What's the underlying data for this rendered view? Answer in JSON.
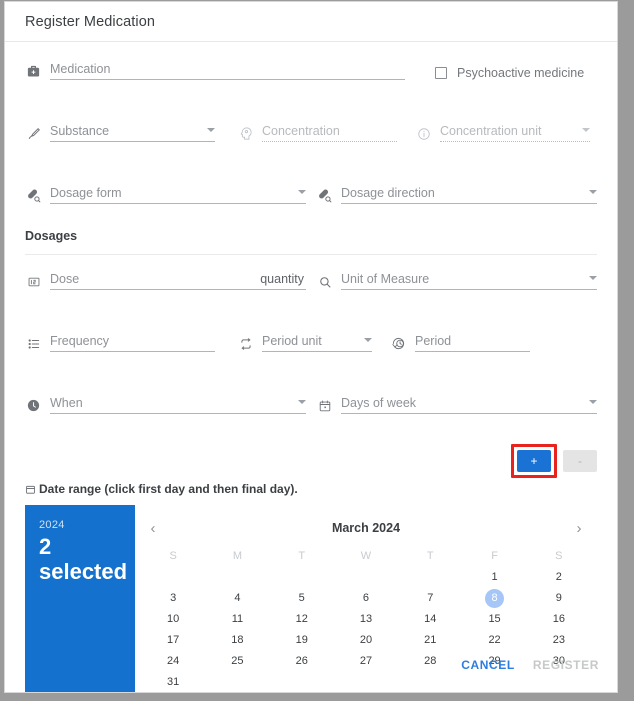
{
  "dialog": {
    "title": "Register Medication"
  },
  "fields": {
    "medication": {
      "placeholder": "Medication",
      "icon": "medical-kit-icon"
    },
    "psychoactive": {
      "label": "Psychoactive medicine",
      "checked": false
    },
    "substance": {
      "placeholder": "Substance",
      "icon": "syringe-icon"
    },
    "concentration": {
      "placeholder": "Concentration",
      "icon": "head-concentration-icon",
      "disabled": true
    },
    "concentration_unit": {
      "placeholder": "Concentration unit",
      "icon": "info-circle-icon",
      "disabled": true
    },
    "dosage_form": {
      "placeholder": "Dosage form",
      "icon": "pill-search-icon"
    },
    "dosage_direction": {
      "placeholder": "Dosage direction",
      "icon": "pill-search-icon"
    },
    "dose": {
      "placeholder": "Dose",
      "suffix": "quantity",
      "icon": "number-box-icon"
    },
    "unit_of_measure": {
      "placeholder": "Unit of Measure",
      "icon": "magnifier-icon"
    },
    "frequency": {
      "placeholder": "Frequency",
      "icon": "list-icon"
    },
    "period_unit": {
      "placeholder": "Period unit",
      "icon": "repeat-icon"
    },
    "period": {
      "placeholder": "Period",
      "icon": "clock-history-icon"
    },
    "when": {
      "placeholder": "When",
      "icon": "clock-icon"
    },
    "days_of_week": {
      "placeholder": "Days of week",
      "icon": "calendar-icon"
    }
  },
  "sections": {
    "dosages_title": "Dosages"
  },
  "dosage_buttons": {
    "add_label": "+",
    "remove_label": "-",
    "add_highlighted": true,
    "remove_disabled": true,
    "highlight_color": "#e8231f",
    "add_color": "#1a73d4"
  },
  "date_range": {
    "label": "Date range (click first day and then final day).",
    "icon": "calendar-icon"
  },
  "calendar": {
    "side": {
      "year": "2024",
      "count": "2",
      "status": "selected",
      "background": "#1471cd"
    },
    "prev_icon": "chevron-left-icon",
    "next_icon": "chevron-right-icon",
    "month_title": "March 2024",
    "day_headers": [
      "S",
      "M",
      "T",
      "W",
      "T",
      "F",
      "S"
    ],
    "lead_blanks": 5,
    "days": [
      1,
      2,
      3,
      4,
      5,
      6,
      7,
      8,
      9,
      10,
      11,
      12,
      13,
      14,
      15,
      16,
      17,
      18,
      19,
      20,
      21,
      22,
      23,
      24,
      25,
      26,
      27,
      28,
      29,
      30,
      31
    ],
    "today": 8,
    "today_color": "#a5c6f7"
  },
  "footer": {
    "cancel_label": "CANCEL",
    "register_label": "REGISTER",
    "register_disabled": true,
    "cancel_color": "#2b7de0"
  }
}
